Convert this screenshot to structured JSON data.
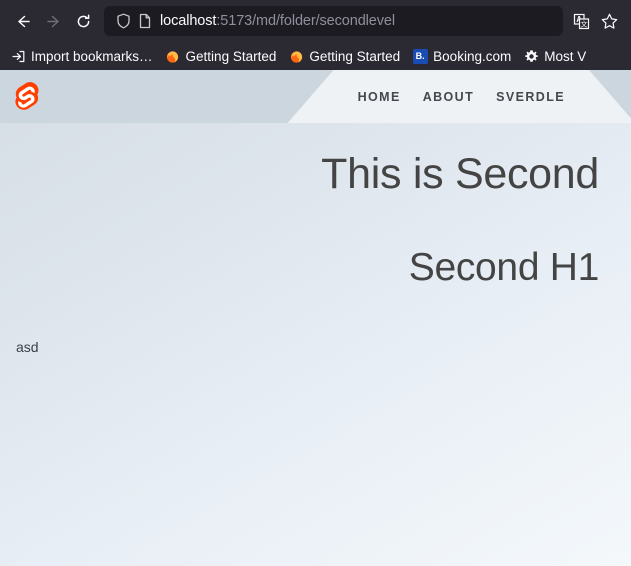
{
  "browser": {
    "back_label": "Back",
    "forward_label": "Forward",
    "reload_label": "Reload",
    "shield_label": "Tracking protection",
    "page_icon_label": "Page info",
    "url_host": "localhost",
    "url_path": ":5173/md/folder/secondlevel",
    "translate_label": "Translate this page",
    "bookmark_label": "Bookmark this page",
    "colors": {
      "toolbar_bg": "#2b2a33",
      "urlbar_bg": "#1c1b22",
      "text": "#fbfbfe",
      "muted_text": "#8f8f9d"
    },
    "bookmarks": [
      {
        "label": "Import bookmarks…",
        "icon": "import-icon"
      },
      {
        "label": "Getting Started",
        "icon": "firefox-icon"
      },
      {
        "label": "Getting Started",
        "icon": "firefox-icon"
      },
      {
        "label": "Booking.com",
        "icon": "booking-favicon"
      },
      {
        "label": "Most V",
        "icon": "gear-icon"
      }
    ]
  },
  "page": {
    "logo_label": "Svelte",
    "logo_color": "#ff3e00",
    "header_bg": "#ccd6de",
    "nav_bg": "#eff2f5",
    "nav": [
      {
        "label": "Home"
      },
      {
        "label": "About"
      },
      {
        "label": "Sverdle"
      }
    ],
    "heading_main": "This is Second",
    "heading_second": "Second H1",
    "paragraph": "asd"
  }
}
